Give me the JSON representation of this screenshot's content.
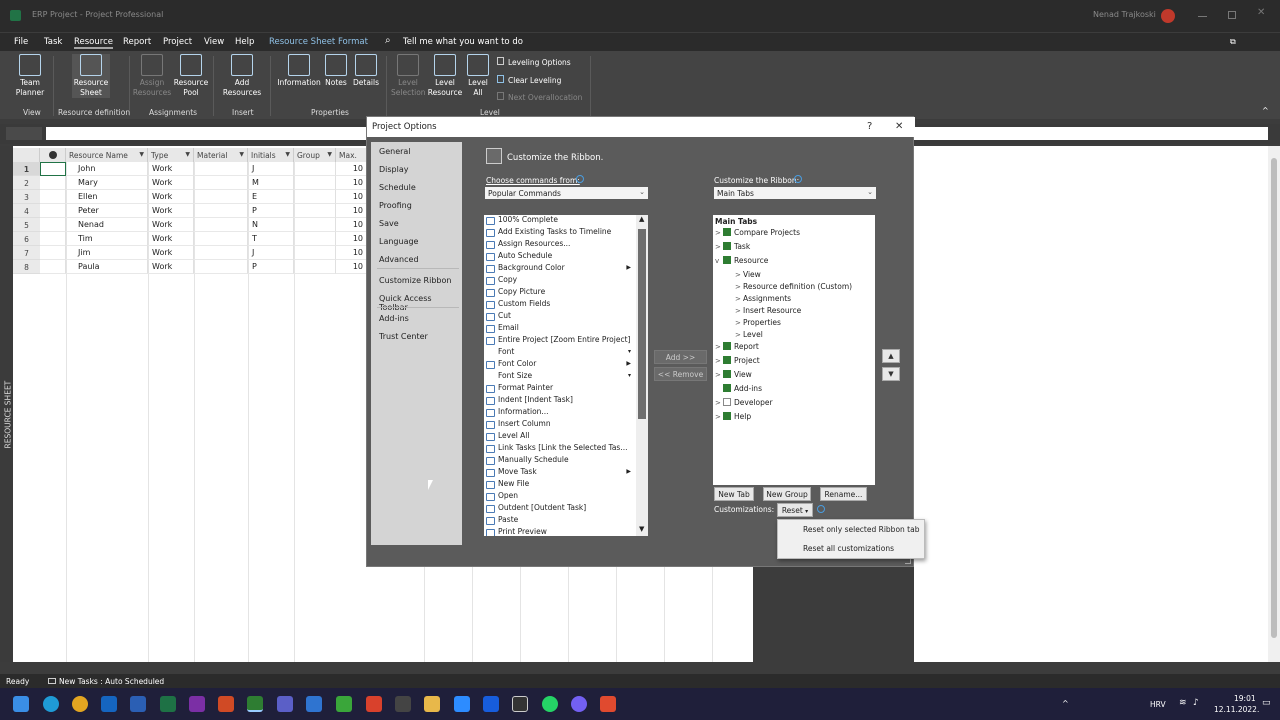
{
  "window": {
    "title": "ERP Project - Project Professional",
    "user": "Nenad Trajkoski"
  },
  "menu": {
    "items": [
      "File",
      "Task",
      "Resource",
      "Report",
      "Project",
      "View",
      "Help"
    ],
    "active": "Resource",
    "context_tab": "Resource Sheet Format",
    "search": "Tell me what you want to do"
  },
  "ribbon": {
    "buttons": [
      {
        "label": "Team\nPlanner",
        "dim": false
      },
      {
        "label": "Resource\nSheet",
        "dim": false
      },
      {
        "label": "Assign\nResources",
        "dim": true
      },
      {
        "label": "Resource\nPool",
        "dim": false
      },
      {
        "label": "Add\nResources",
        "dim": false
      },
      {
        "label": "Information",
        "dim": false
      },
      {
        "label": "Notes",
        "dim": false
      },
      {
        "label": "Details",
        "dim": false
      },
      {
        "label": "Level\nSelection",
        "dim": true
      },
      {
        "label": "Level\nResource",
        "dim": false
      },
      {
        "label": "Level\nAll",
        "dim": false
      }
    ],
    "small": {
      "leveling_options": "Leveling Options",
      "clear_leveling": "Clear Leveling",
      "next_overallocation": "Next Overallocation"
    },
    "groups": {
      "view": "View",
      "resource_definition": "Resource definition",
      "assignments": "Assignments",
      "insert": "Insert",
      "properties": "Properties",
      "level": "Level"
    }
  },
  "sheet": {
    "side_label": "RESOURCE SHEET",
    "headers": [
      "Resource Name",
      "Type",
      "Material",
      "Initials",
      "Group",
      "Max."
    ],
    "rows": [
      {
        "n": "1",
        "name": "John",
        "type": "Work",
        "ini": "J",
        "max": "10"
      },
      {
        "n": "2",
        "name": "Mary",
        "type": "Work",
        "ini": "M",
        "max": "10"
      },
      {
        "n": "3",
        "name": "Ellen",
        "type": "Work",
        "ini": "E",
        "max": "10"
      },
      {
        "n": "4",
        "name": "Peter",
        "type": "Work",
        "ini": "P",
        "max": "10"
      },
      {
        "n": "5",
        "name": "Nenad",
        "type": "Work",
        "ini": "N",
        "max": "10"
      },
      {
        "n": "6",
        "name": "Tim",
        "type": "Work",
        "ini": "T",
        "max": "10"
      },
      {
        "n": "7",
        "name": "Jim",
        "type": "Work",
        "ini": "J",
        "max": "10"
      },
      {
        "n": "8",
        "name": "Paula",
        "type": "Work",
        "ini": "P",
        "max": "10"
      }
    ]
  },
  "status": {
    "ready": "Ready",
    "new_tasks": "New Tasks : Auto Scheduled"
  },
  "dialog": {
    "title": "Project Options",
    "help": "?",
    "close": "✕",
    "nav": [
      "General",
      "Display",
      "Schedule",
      "Proofing",
      "Save",
      "Language",
      "Advanced",
      "Customize Ribbon",
      "Quick Access Toolbar",
      "Add-ins",
      "Trust Center"
    ],
    "heading": "Customize the Ribbon.",
    "choose_label": "Choose commands from:",
    "choose_value": "Popular Commands",
    "customize_label": "Customize the Ribbon:",
    "customize_value": "Main Tabs",
    "commands": [
      "100% Complete",
      "Add Existing Tasks to Timeline",
      "Assign Resources...",
      "Auto Schedule",
      "Background Color",
      "Copy",
      "Copy Picture",
      "Custom Fields",
      "Cut",
      "Email",
      "Entire Project [Zoom Entire Project]",
      "Font",
      "Font Color",
      "Font Size",
      "Format Painter",
      "Indent [Indent Task]",
      "Information...",
      "Insert Column",
      "Level All",
      "Link Tasks [Link the Selected Tas...",
      "Manually Schedule",
      "Move Task",
      "New File",
      "Open",
      "Outdent [Outdent Task]",
      "Paste",
      "Print Preview"
    ],
    "add_btn": "Add >>",
    "remove_btn": "<< Remove",
    "tabs_header": "Main Tabs",
    "tabs": [
      {
        "label": "Compare Projects",
        "level": 0,
        "cb": true,
        "caret": ">"
      },
      {
        "label": "Task",
        "level": 0,
        "cb": true,
        "caret": ">"
      },
      {
        "label": "Resource",
        "level": 0,
        "cb": true,
        "caret": "v"
      },
      {
        "label": "View",
        "level": 1,
        "cb": null,
        "caret": ">"
      },
      {
        "label": "Resource definition (Custom)",
        "level": 1,
        "cb": null,
        "caret": ">"
      },
      {
        "label": "Assignments",
        "level": 1,
        "cb": null,
        "caret": ">"
      },
      {
        "label": "Insert Resource",
        "level": 1,
        "cb": null,
        "caret": ">"
      },
      {
        "label": "Properties",
        "level": 1,
        "cb": null,
        "caret": ">"
      },
      {
        "label": "Level",
        "level": 1,
        "cb": null,
        "caret": ">"
      },
      {
        "label": "Report",
        "level": 0,
        "cb": true,
        "caret": ">"
      },
      {
        "label": "Project",
        "level": 0,
        "cb": true,
        "caret": ">"
      },
      {
        "label": "View",
        "level": 0,
        "cb": true,
        "caret": ">"
      },
      {
        "label": "Add-ins",
        "level": 0,
        "cb": true,
        "caret": ""
      },
      {
        "label": "Developer",
        "level": 0,
        "cb": false,
        "caret": ">"
      },
      {
        "label": "Help",
        "level": 0,
        "cb": true,
        "caret": ">"
      }
    ],
    "new_tab": "New Tab",
    "new_group": "New Group",
    "rename": "Rename...",
    "customizations_label": "Customizations:",
    "reset": "Reset",
    "reset_menu": [
      "Reset only selected Ribbon tab",
      "Reset all customizations"
    ]
  },
  "taskbar": {
    "lang": "HRV",
    "time": "19:01",
    "date": "12.11.2022."
  }
}
